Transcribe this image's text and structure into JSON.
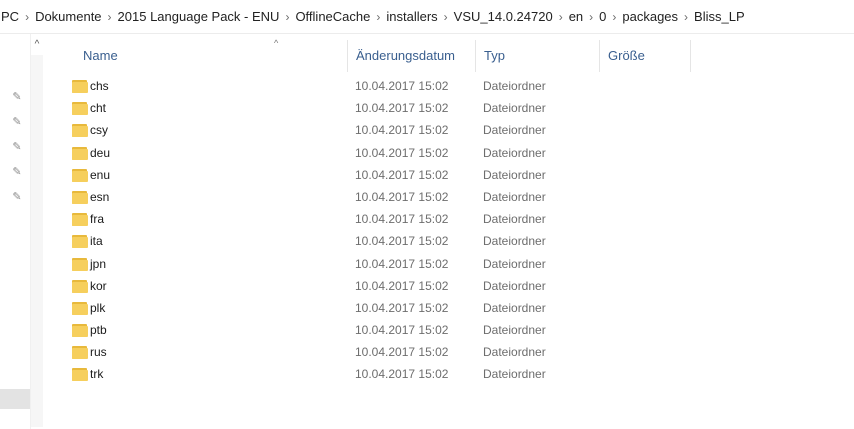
{
  "breadcrumb": [
    "PC",
    "Dokumente",
    "2015 Language Pack - ENU",
    "OfflineCache",
    "installers",
    "VSU_14.0.24720",
    "en",
    "0",
    "packages",
    "Bliss_LP"
  ],
  "breadcrumb_separator": "›",
  "columns": {
    "name": "Name",
    "date": "Änderungsdatum",
    "type": "Typ",
    "size": "Größe"
  },
  "sort_indicator": "^",
  "nav_scroll_up": "^",
  "files": [
    {
      "name": "chs",
      "date": "10.04.2017 15:02",
      "type": "Dateiordner"
    },
    {
      "name": "cht",
      "date": "10.04.2017 15:02",
      "type": "Dateiordner"
    },
    {
      "name": "csy",
      "date": "10.04.2017 15:02",
      "type": "Dateiordner"
    },
    {
      "name": "deu",
      "date": "10.04.2017 15:02",
      "type": "Dateiordner"
    },
    {
      "name": "enu",
      "date": "10.04.2017 15:02",
      "type": "Dateiordner"
    },
    {
      "name": "esn",
      "date": "10.04.2017 15:02",
      "type": "Dateiordner"
    },
    {
      "name": "fra",
      "date": "10.04.2017 15:02",
      "type": "Dateiordner"
    },
    {
      "name": "ita",
      "date": "10.04.2017 15:02",
      "type": "Dateiordner"
    },
    {
      "name": "jpn",
      "date": "10.04.2017 15:02",
      "type": "Dateiordner"
    },
    {
      "name": "kor",
      "date": "10.04.2017 15:02",
      "type": "Dateiordner"
    },
    {
      "name": "plk",
      "date": "10.04.2017 15:02",
      "type": "Dateiordner"
    },
    {
      "name": "ptb",
      "date": "10.04.2017 15:02",
      "type": "Dateiordner"
    },
    {
      "name": "rus",
      "date": "10.04.2017 15:02",
      "type": "Dateiordner"
    },
    {
      "name": "trk",
      "date": "10.04.2017 15:02",
      "type": "Dateiordner"
    }
  ],
  "icons": {
    "folder": "folder-icon",
    "pin": "pin-icon"
  },
  "colors": {
    "folder": "#f6cf5d",
    "header_text": "#3a5f8f"
  }
}
